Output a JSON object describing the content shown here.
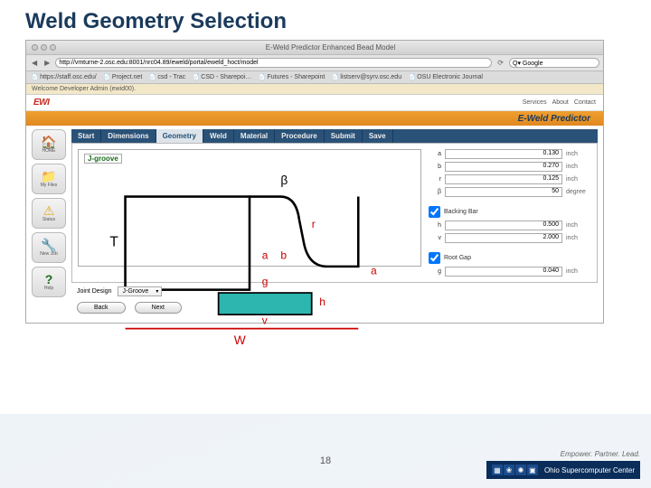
{
  "slide": {
    "title": "Weld Geometry Selection",
    "page_num": "18"
  },
  "browser": {
    "window_title": "E-Weld Predictor Enhanced Bead Model",
    "url": "http://vmturne-2.osc.edu:8001/nrc04.89/eweld/portal/eweld_hoct/model",
    "search_placeholder": "Q▾ Google",
    "bookmarks": [
      "https://staff.osc.edu/",
      "Project.net",
      "csd - Trac",
      "CSD - Sharepoi…",
      "Futures - Sharepoint",
      "listserv@syrv.osc.edu",
      "OSU Electronic Journal"
    ],
    "welcome": "Welcome Developer Admin (ewid00)."
  },
  "ewi": {
    "logo": "EWI",
    "links": [
      "Services",
      "About",
      "Contact"
    ],
    "app_title": "E-Weld Predictor"
  },
  "left_icons": [
    {
      "glyph": "🏠",
      "label": "HOME"
    },
    {
      "glyph": "📁",
      "label": "My Files"
    },
    {
      "glyph": "⚠",
      "label": "Status"
    },
    {
      "glyph": "🔧",
      "label": "New Job"
    },
    {
      "glyph": "?",
      "label": "Help"
    }
  ],
  "tabs": [
    "Start",
    "Dimensions",
    "Geometry",
    "Weld",
    "Material",
    "Procedure",
    "Submit",
    "Save"
  ],
  "active_tab": "Geometry",
  "diagram": {
    "label": "J-groove"
  },
  "params": {
    "rows": [
      {
        "lbl": "a",
        "val": "0.130",
        "unit": "inch"
      },
      {
        "lbl": "b",
        "val": "0.270",
        "unit": "inch"
      },
      {
        "lbl": "r",
        "val": "0.125",
        "unit": "inch"
      },
      {
        "lbl": "β",
        "val": "50",
        "unit": "degree"
      }
    ],
    "backing": {
      "label": "Backing Bar",
      "checked": true
    },
    "backing_rows": [
      {
        "lbl": "h",
        "val": "0.500",
        "unit": "inch"
      },
      {
        "lbl": "v",
        "val": "2.000",
        "unit": "inch"
      }
    ],
    "rootgap": {
      "label": "Root Gap",
      "checked": true
    },
    "root_rows": [
      {
        "lbl": "g",
        "val": "0.040",
        "unit": "inch"
      }
    ]
  },
  "design": {
    "label": "Joint Design",
    "value": "J-Groove"
  },
  "nav": {
    "back": "Back",
    "next": "Next"
  },
  "footer": {
    "tagline": "Empower. Partner. Lead.",
    "org": "Ohio Supercomputer Center"
  }
}
